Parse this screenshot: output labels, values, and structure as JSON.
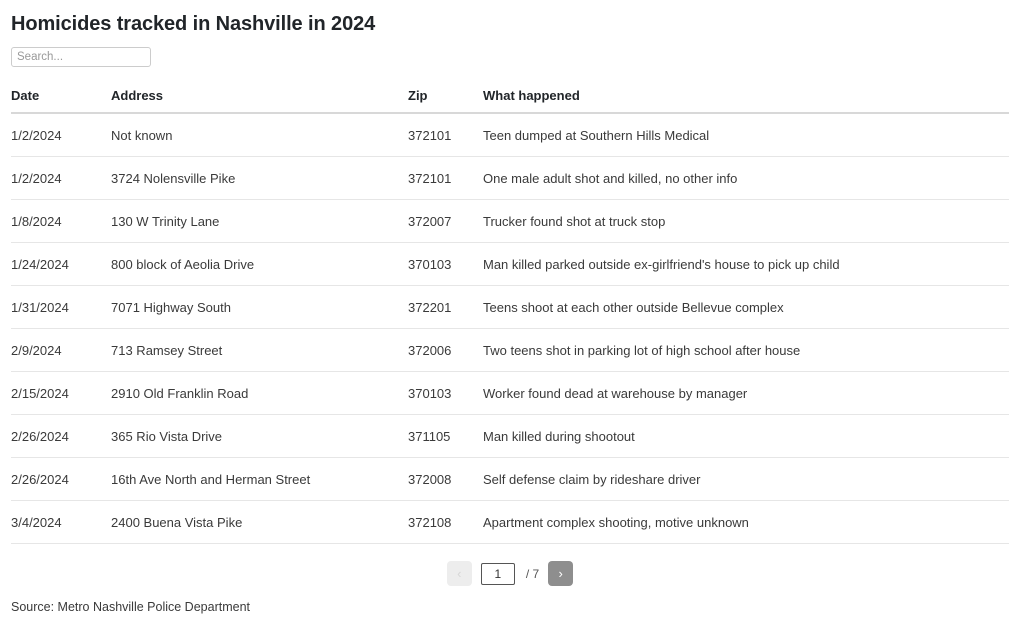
{
  "header": {
    "title": "Homicides tracked in Nashville in 2024"
  },
  "search": {
    "placeholder": "Search...",
    "value": ""
  },
  "table": {
    "columns": [
      "Date",
      "Address",
      "Zip",
      "What happened"
    ],
    "rows": [
      {
        "date": "1/2/2024",
        "address": "Not known",
        "zip": "372101",
        "what_happened": "Teen dumped at Southern Hills Medical"
      },
      {
        "date": "1/2/2024",
        "address": "3724 Nolensville Pike",
        "zip": "372101",
        "what_happened": "One male adult shot and killed, no other info"
      },
      {
        "date": "1/8/2024",
        "address": "130 W Trinity Lane",
        "zip": "372007",
        "what_happened": "Trucker found shot at truck stop"
      },
      {
        "date": "1/24/2024",
        "address": "800 block of Aeolia Drive",
        "zip": "370103",
        "what_happened": "Man killed parked outside ex-girlfriend's house to pick up child"
      },
      {
        "date": "1/31/2024",
        "address": "7071 Highway South",
        "zip": "372201",
        "what_happened": "Teens shoot at each other outside Bellevue complex"
      },
      {
        "date": "2/9/2024",
        "address": "713 Ramsey Street",
        "zip": "372006",
        "what_happened": "Two teens shot in parking lot of high school after house"
      },
      {
        "date": "2/15/2024",
        "address": "2910 Old Franklin Road",
        "zip": "370103",
        "what_happened": "Worker found dead at warehouse by manager"
      },
      {
        "date": "2/26/2024",
        "address": "365 Rio Vista Drive",
        "zip": "371105",
        "what_happened": "Man killed during shootout"
      },
      {
        "date": "2/26/2024",
        "address": "16th Ave North and Herman Street",
        "zip": "372008",
        "what_happened": "Self defense claim by rideshare driver"
      },
      {
        "date": "3/4/2024",
        "address": "2400 Buena Vista Pike",
        "zip": "372108",
        "what_happened": "Apartment complex shooting, motive unknown"
      }
    ]
  },
  "pagination": {
    "prev_label": "‹",
    "next_label": "›",
    "current_page": "1",
    "total_label": "/ 7",
    "total_pages": 7,
    "prev_disabled": true,
    "next_disabled": false
  },
  "footer": {
    "source": "Source: Metro Nashville Police Department"
  },
  "colors": {
    "title": "#212529",
    "text": "#3a3a3a",
    "row_border": "#e6e6e6",
    "header_border": "#d8d8d8",
    "next_button_bg": "#8e8e8e",
    "prev_button_bg": "#ededed"
  }
}
